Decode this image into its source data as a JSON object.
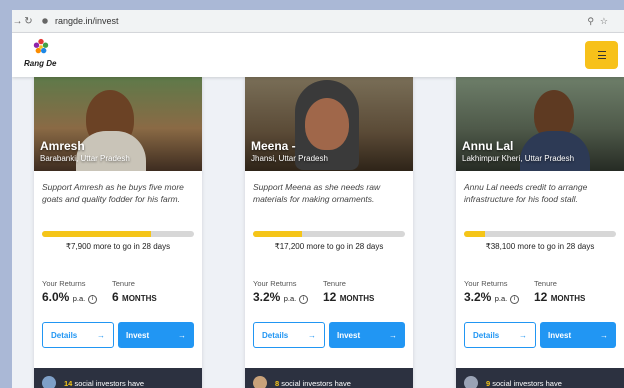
{
  "browser": {
    "url": "rangde.in/invest",
    "back_icon": "arrow-left-icon",
    "reload_icon": "reload-icon"
  },
  "header": {
    "logo_text": "Rang De",
    "menu_icon": "hamburger-icon",
    "accent_color": "#f7c11a"
  },
  "cards": [
    {
      "name": "Amresh",
      "place": "Barabanki, Uttar Pradesh",
      "description": "Support Amresh as he buys five more goats and quality fodder for his farm.",
      "progress": 0.72,
      "to_go": "₹7,900 more to go in 28 days",
      "returns_label": "Your Returns",
      "returns_value": "6.0%",
      "returns_unit": "p.a.",
      "tenure_label": "Tenure",
      "tenure_value": "6",
      "tenure_unit": "MONTHS",
      "details_label": "Details",
      "invest_label": "Invest",
      "investors_count": "14",
      "investors_text": "social investors have"
    },
    {
      "name": "Meena -",
      "place": "Jhansi, Uttar Pradesh",
      "description": "Support Meena as she needs raw materials for making ornaments.",
      "progress": 0.32,
      "to_go": "₹17,200 more to go in 28 days",
      "returns_label": "Your Returns",
      "returns_value": "3.2%",
      "returns_unit": "p.a.",
      "tenure_label": "Tenure",
      "tenure_value": "12",
      "tenure_unit": "MONTHS",
      "details_label": "Details",
      "invest_label": "Invest",
      "investors_count": "8",
      "investors_text": "social investors have"
    },
    {
      "name": "Annu Lal",
      "place": "Lakhimpur Kheri, Uttar Pradesh",
      "description": "Annu Lal needs credit to arrange infrastructure for his food stall.",
      "progress": 0.14,
      "to_go": "₹38,100 more to go in 28 days",
      "returns_label": "Your Returns",
      "returns_value": "3.2%",
      "returns_unit": "p.a.",
      "tenure_label": "Tenure",
      "tenure_value": "12",
      "tenure_unit": "MONTHS",
      "details_label": "Details",
      "invest_label": "Invest",
      "investors_count": "9",
      "investors_text": "social investors have"
    }
  ]
}
